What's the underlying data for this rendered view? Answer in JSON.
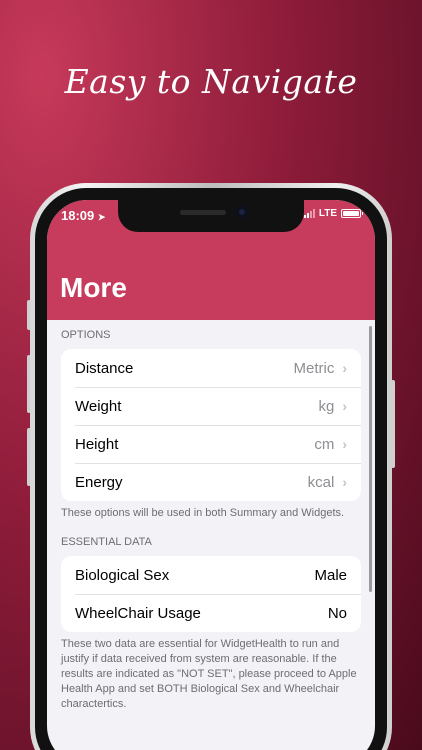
{
  "headline": "Easy to Navigate",
  "status": {
    "time": "18:09",
    "network": "LTE"
  },
  "title": "More",
  "options": {
    "header": "OPTIONS",
    "rows": [
      {
        "label": "Distance",
        "value": "Metric"
      },
      {
        "label": "Weight",
        "value": "kg"
      },
      {
        "label": "Height",
        "value": "cm"
      },
      {
        "label": "Energy",
        "value": "kcal"
      }
    ],
    "footer": "These options will be used in both Summary and Widgets."
  },
  "essential": {
    "header": "ESSENTIAL DATA",
    "rows": [
      {
        "label": "Biological Sex",
        "value": "Male"
      },
      {
        "label": "WheelChair Usage",
        "value": "No"
      }
    ],
    "footer": "These two data are essential for WidgetHealth to run and justify if data received from system are reasonable. If the results are indicated as \"NOT SET\", please proceed to Apple Health App and set BOTH Biological Sex and Wheelchair charactertics."
  },
  "colors": {
    "accent": "#c73b5c",
    "background": "#f2f2f7"
  },
  "icons": {
    "chevron": "chevron-right-icon",
    "location": "location-arrow-icon"
  }
}
